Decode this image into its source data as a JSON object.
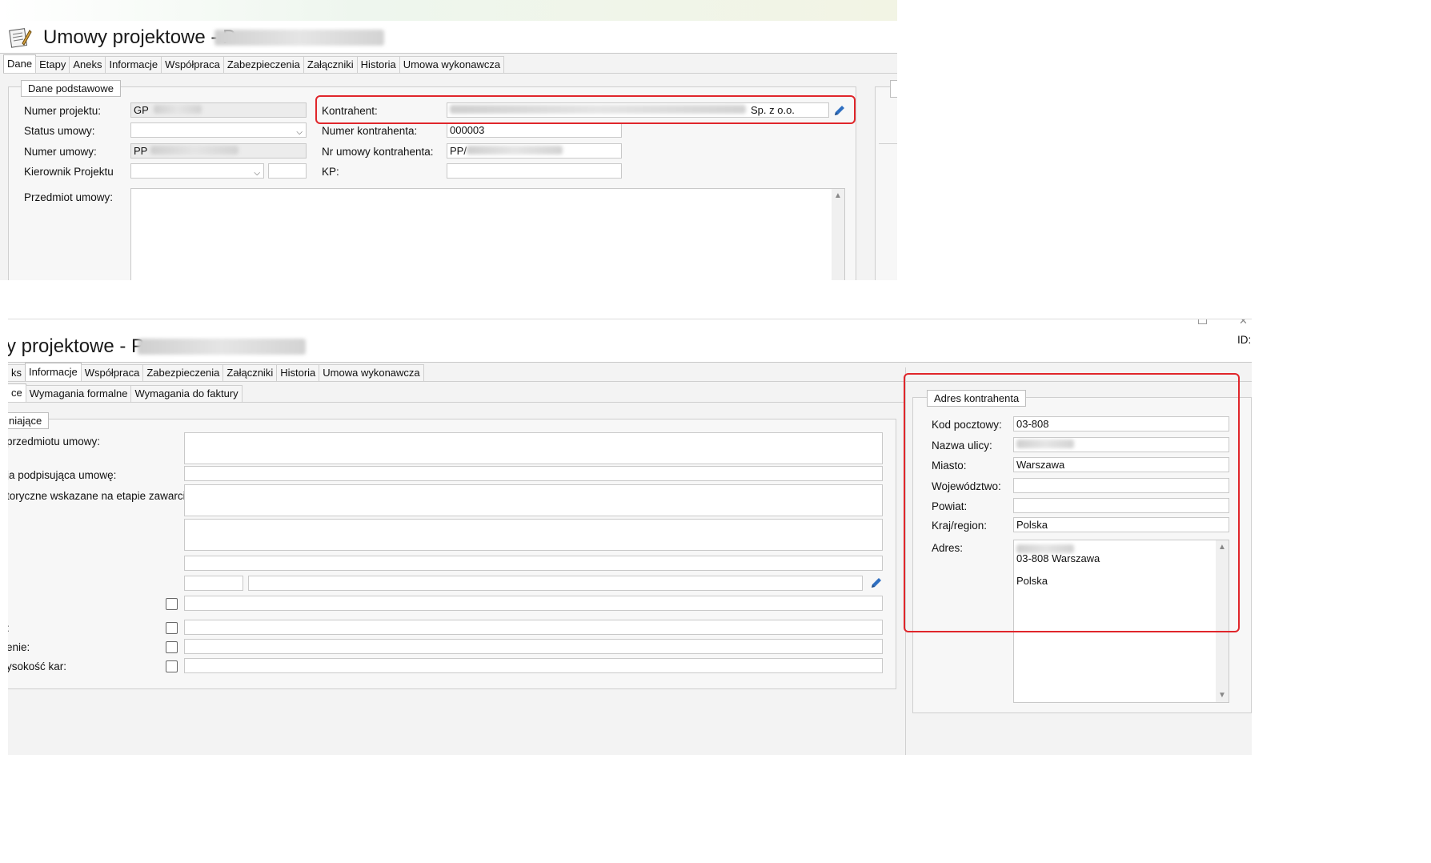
{
  "top": {
    "title": "Umowy projektowe - P",
    "tabs": [
      "Dane",
      "Etapy",
      "Aneks",
      "Informacje",
      "Współpraca",
      "Zabezpieczenia",
      "Załączniki",
      "Historia",
      "Umowa wykonawcza"
    ],
    "group_label": "Dane podstawowe",
    "fields": {
      "numer_projektu_label": "Numer projektu:",
      "numer_projektu_value": "GP",
      "status_umowy_label": "Status umowy:",
      "numer_umowy_label": "Numer umowy:",
      "numer_umowy_value": "PP",
      "kierownik_label": "Kierownik Projektu",
      "przedmiot_label": "Przedmiot umowy:",
      "kontrahent_label": "Kontrahent:",
      "kontrahent_value_suffix": "Sp. z o.o.",
      "numer_kontrahenta_label": "Numer kontrahenta:",
      "numer_kontrahenta_value": "000003",
      "nr_umowy_kontrahenta_label": "Nr umowy kontrahenta:",
      "nr_umowy_kontrahenta_value": "PP/",
      "kp_label": "KP:"
    }
  },
  "bottom": {
    "title": "y projektowe - P",
    "id_label": "ID:",
    "tabs": [
      "ks",
      "Informacje",
      "Współpraca",
      "Zabezpieczenia",
      "Załączniki",
      "Historia",
      "Umowa wykonawcza"
    ],
    "subtabs": [
      "ce",
      "Wymagania formalne",
      "Wymagania do faktury"
    ],
    "group_label": "niające",
    "left_labels": {
      "przedmiot": "przedmiotu umowy:",
      "podpisujaca": "ja podpisująca umowę:",
      "toryczne": "toryczne wskazane na etapie zawarcia:",
      "colon": ":",
      "enie": "enie:",
      "wysokosc": "ysokość kar:"
    },
    "address": {
      "group_label": "Adres kontrahenta",
      "kod_label": "Kod pocztowy:",
      "kod_value": "03-808",
      "ulica_label": "Nazwa ulicy:",
      "miasto_label": "Miasto:",
      "miasto_value": "Warszawa",
      "wojewodztwo_label": "Województwo:",
      "powiat_label": "Powiat:",
      "kraj_label": "Kraj/region:",
      "kraj_value": "Polska",
      "adres_label": "Adres:",
      "adres_line2": "03-808 Warszawa",
      "adres_line3": "Polska"
    }
  },
  "colors": {
    "highlight": "#e0262b",
    "pencil": "#2f6fc1"
  }
}
